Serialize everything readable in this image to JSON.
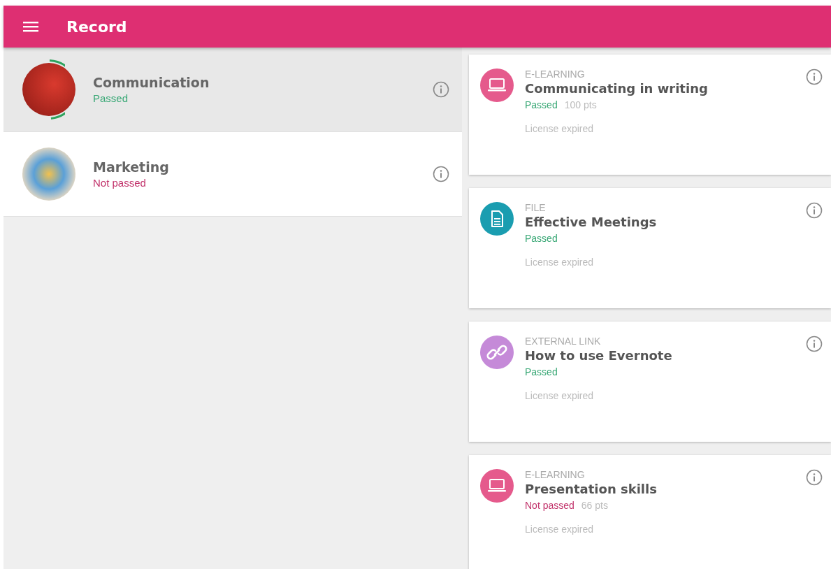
{
  "app_bar": {
    "title": "Record"
  },
  "courses": [
    {
      "name": "Communication",
      "passed": true,
      "status_text": "Passed",
      "selected": true
    },
    {
      "name": "Marketing",
      "passed": false,
      "status_text": "Not passed",
      "selected": false
    }
  ],
  "items": [
    {
      "kind": "elearning",
      "type_label": "E-LEARNING",
      "title": "Communicating in writing",
      "passed": true,
      "status_text": "Passed",
      "points": "100 pts",
      "license": "License expired"
    },
    {
      "kind": "file",
      "type_label": "FILE",
      "title": "Effective Meetings",
      "passed": true,
      "status_text": "Passed",
      "license": "License expired"
    },
    {
      "kind": "link",
      "type_label": "EXTERNAL LINK",
      "title": "How to use Evernote",
      "passed": true,
      "status_text": "Passed",
      "license": "License expired"
    },
    {
      "kind": "elearning",
      "type_label": "E-LEARNING",
      "title": "Presentation skills",
      "passed": false,
      "status_text": "Not passed",
      "points": "66 pts",
      "license": "License expired"
    }
  ]
}
